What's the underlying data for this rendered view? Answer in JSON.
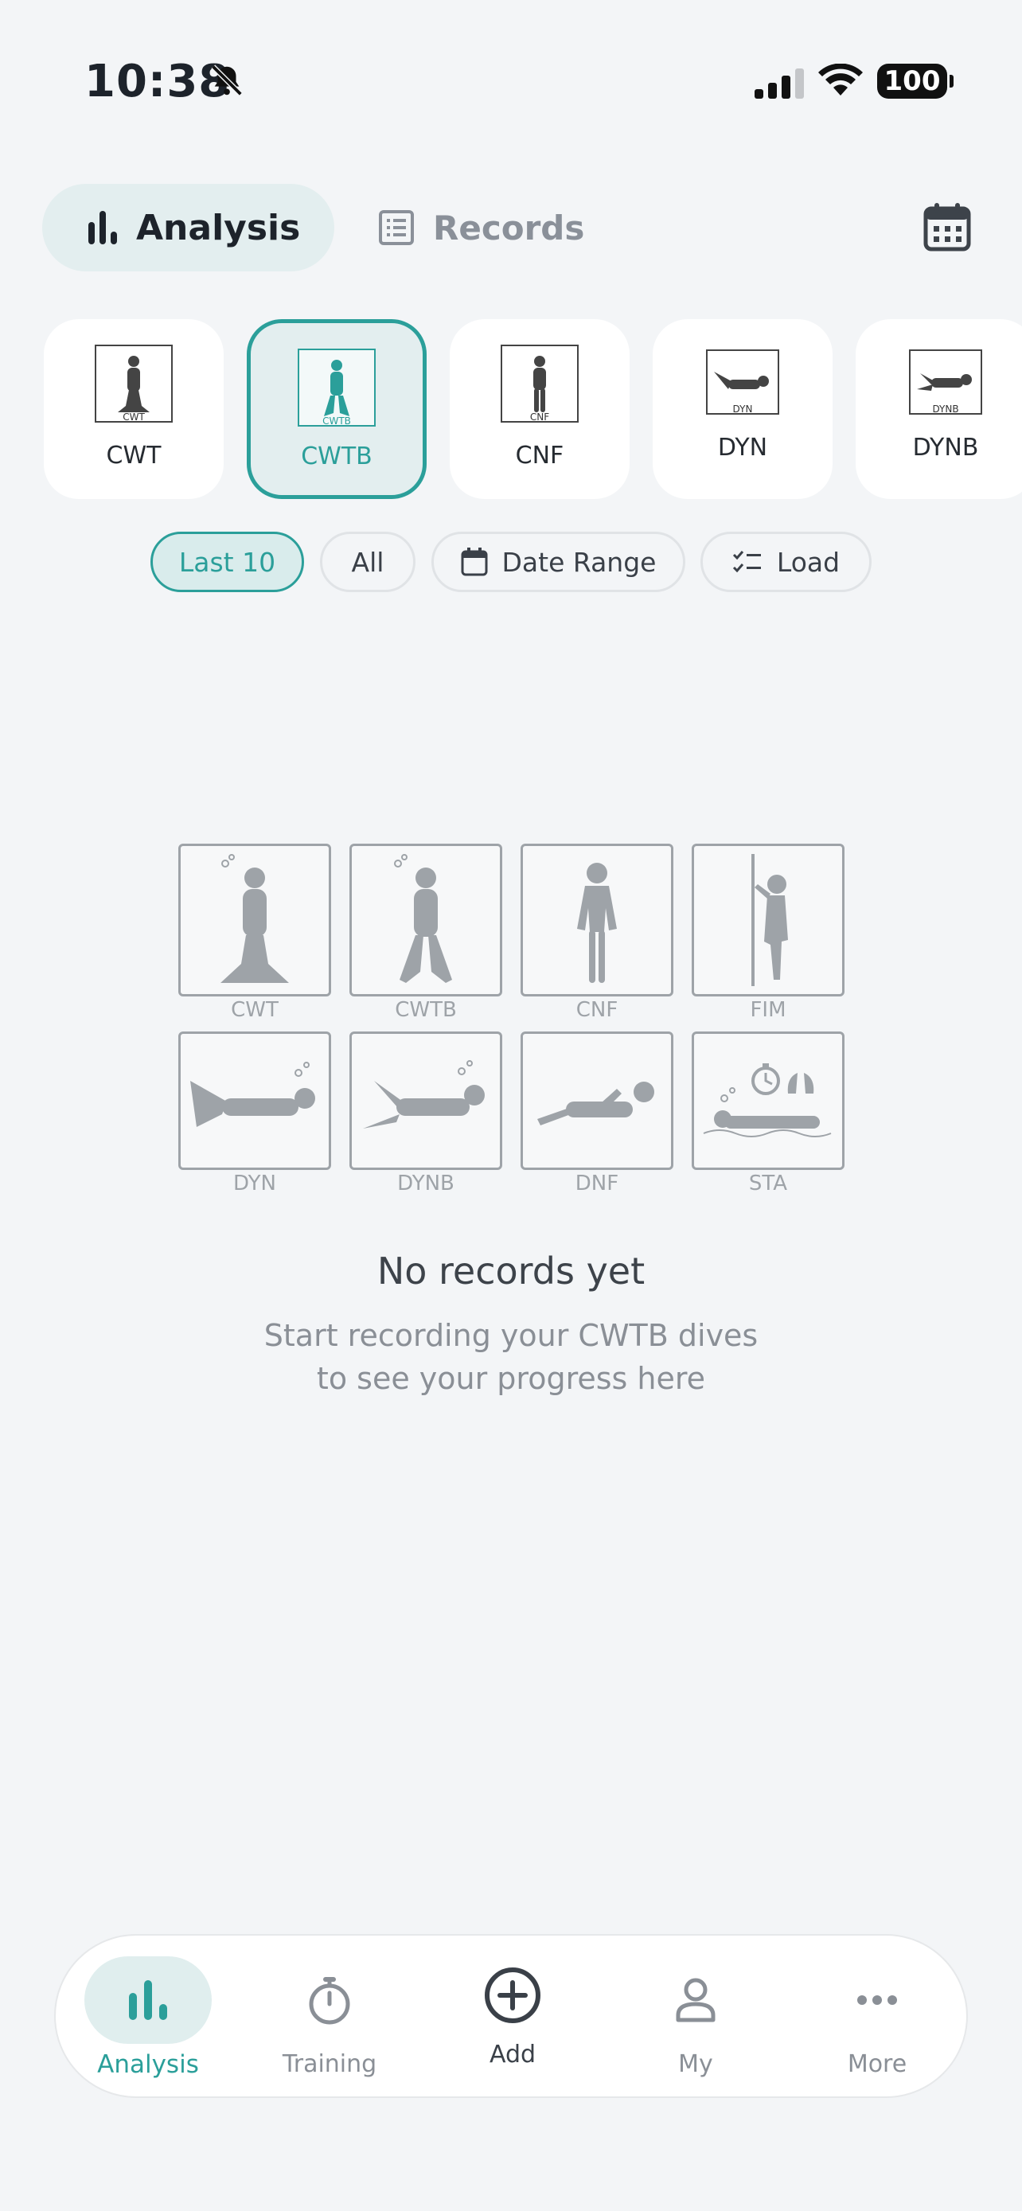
{
  "status_bar": {
    "time": "10:38",
    "battery": "100"
  },
  "header": {
    "tabs": [
      {
        "label": "Analysis",
        "active": true
      },
      {
        "label": "Records",
        "active": false
      }
    ]
  },
  "disciplines": [
    {
      "name": "CWT",
      "code": "CWT",
      "selected": false
    },
    {
      "name": "CWTB",
      "code": "CWTB",
      "selected": true
    },
    {
      "name": "CNF",
      "code": "CNF",
      "selected": false
    },
    {
      "name": "DYN",
      "code": "DYN",
      "selected": false
    },
    {
      "name": "DYNB",
      "code": "DYNB",
      "selected": false
    }
  ],
  "filters": [
    {
      "label": "Last 10",
      "selected": true
    },
    {
      "label": "All",
      "selected": false
    },
    {
      "label": "Date Range",
      "selected": false
    },
    {
      "label": "Load",
      "selected": false
    }
  ],
  "empty_state": {
    "icons": [
      {
        "label": "CWT"
      },
      {
        "label": "CWTB"
      },
      {
        "label": "CNF"
      },
      {
        "label": "FIM"
      },
      {
        "label": "DYN"
      },
      {
        "label": "DYNB"
      },
      {
        "label": "DNF"
      },
      {
        "label": "STA"
      }
    ],
    "title": "No records yet",
    "subtitle_line1": "Start recording your CWTB dives",
    "subtitle_line2": "to see your progress here"
  },
  "bottom_nav": [
    {
      "label": "Analysis",
      "icon": "bar-chart-icon",
      "active": true
    },
    {
      "label": "Training",
      "icon": "stopwatch-icon",
      "active": false
    },
    {
      "label": "Add",
      "icon": "plus-circle-icon",
      "active": false
    },
    {
      "label": "My",
      "icon": "person-icon",
      "active": false
    },
    {
      "label": "More",
      "icon": "more-dots-icon",
      "active": false
    }
  ],
  "colors": {
    "accent": "#2b9f9a",
    "background": "#f3f5f7",
    "muted": "#8a8f96"
  }
}
